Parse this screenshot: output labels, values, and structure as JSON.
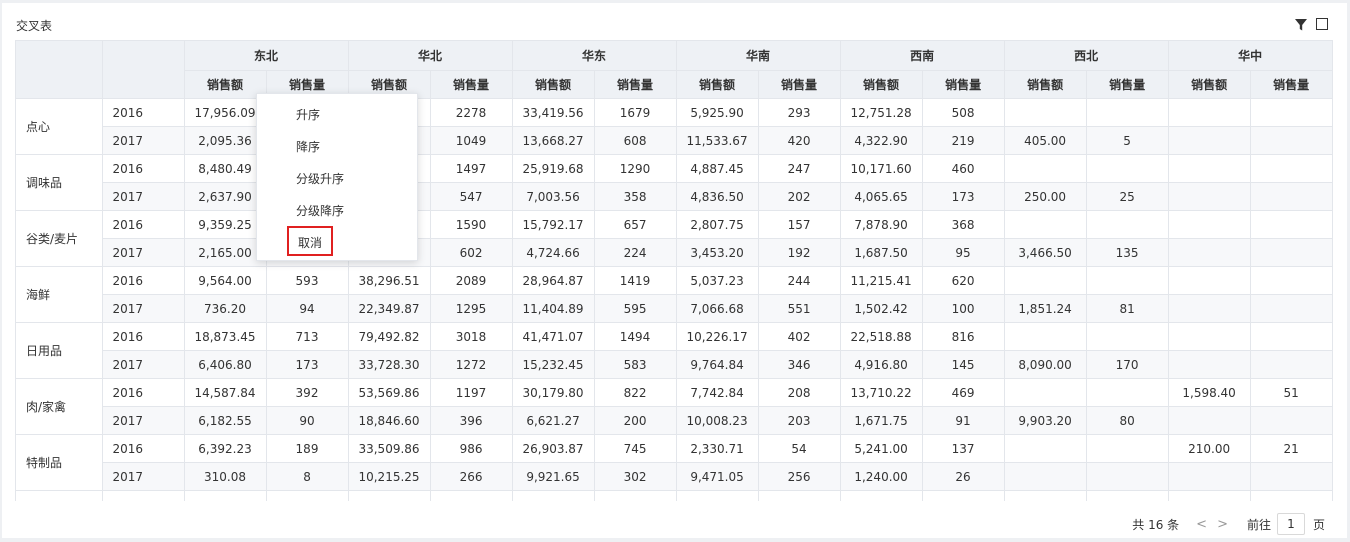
{
  "title": "交叉表",
  "regions": [
    "东北",
    "华北",
    "华东",
    "华南",
    "西南",
    "西北",
    "华中"
  ],
  "measures": [
    "销售额",
    "销售量"
  ],
  "rows": [
    {
      "category": "点心",
      "year": "2016",
      "values": [
        "17,956.09",
        "",
        "",
        "2278",
        "33,419.56",
        "1679",
        "5,925.90",
        "293",
        "12,751.28",
        "508",
        "",
        "",
        "",
        ""
      ]
    },
    {
      "category": "点心",
      "year": "2017",
      "values": [
        "2,095.36",
        "",
        "",
        "1049",
        "13,668.27",
        "608",
        "11,533.67",
        "420",
        "4,322.90",
        "219",
        "405.00",
        "5",
        "",
        ""
      ]
    },
    {
      "category": "调味品",
      "year": "2016",
      "values": [
        "8,480.49",
        "",
        "",
        "1497",
        "25,919.68",
        "1290",
        "4,887.45",
        "247",
        "10,171.60",
        "460",
        "",
        "",
        "",
        ""
      ]
    },
    {
      "category": "调味品",
      "year": "2017",
      "values": [
        "2,637.90",
        "",
        "",
        "547",
        "7,003.56",
        "358",
        "4,836.50",
        "202",
        "4,065.65",
        "173",
        "250.00",
        "25",
        "",
        ""
      ]
    },
    {
      "category": "谷类/麦片",
      "year": "2016",
      "values": [
        "9,359.25",
        "",
        "",
        "1590",
        "15,792.17",
        "657",
        "2,807.75",
        "157",
        "7,878.90",
        "368",
        "",
        "",
        "",
        ""
      ]
    },
    {
      "category": "谷类/麦片",
      "year": "2017",
      "values": [
        "2,165.00",
        "",
        "",
        "602",
        "4,724.66",
        "224",
        "3,453.20",
        "192",
        "1,687.50",
        "95",
        "3,466.50",
        "135",
        "",
        ""
      ]
    },
    {
      "category": "海鲜",
      "year": "2016",
      "values": [
        "9,564.00",
        "593",
        "38,296.51",
        "2089",
        "28,964.87",
        "1419",
        "5,037.23",
        "244",
        "11,215.41",
        "620",
        "",
        "",
        "",
        ""
      ]
    },
    {
      "category": "海鲜",
      "year": "2017",
      "values": [
        "736.20",
        "94",
        "22,349.87",
        "1295",
        "11,404.89",
        "595",
        "7,066.68",
        "551",
        "1,502.42",
        "100",
        "1,851.24",
        "81",
        "",
        ""
      ]
    },
    {
      "category": "日用品",
      "year": "2016",
      "values": [
        "18,873.45",
        "713",
        "79,492.82",
        "3018",
        "41,471.07",
        "1494",
        "10,226.17",
        "402",
        "22,518.88",
        "816",
        "",
        "",
        "",
        ""
      ]
    },
    {
      "category": "日用品",
      "year": "2017",
      "values": [
        "6,406.80",
        "173",
        "33,728.30",
        "1272",
        "15,232.45",
        "583",
        "9,764.84",
        "346",
        "4,916.80",
        "145",
        "8,090.00",
        "170",
        "",
        ""
      ]
    },
    {
      "category": "肉/家禽",
      "year": "2016",
      "values": [
        "14,587.84",
        "392",
        "53,569.86",
        "1197",
        "30,179.80",
        "822",
        "7,742.84",
        "208",
        "13,710.22",
        "469",
        "",
        "",
        "1,598.40",
        "51"
      ]
    },
    {
      "category": "肉/家禽",
      "year": "2017",
      "values": [
        "6,182.55",
        "90",
        "18,846.60",
        "396",
        "6,621.27",
        "200",
        "10,008.23",
        "203",
        "1,671.75",
        "91",
        "9,903.20",
        "80",
        "",
        ""
      ]
    },
    {
      "category": "特制品",
      "year": "2016",
      "values": [
        "6,392.23",
        "189",
        "33,509.86",
        "986",
        "26,903.87",
        "745",
        "2,330.71",
        "54",
        "5,241.00",
        "137",
        "",
        "",
        "210.00",
        "21"
      ]
    },
    {
      "category": "特制品",
      "year": "2017",
      "values": [
        "310.08",
        "8",
        "10,215.25",
        "266",
        "9,921.65",
        "302",
        "9,471.05",
        "256",
        "1,240.00",
        "26",
        "",
        "",
        "",
        ""
      ]
    }
  ],
  "context_menu": {
    "items": [
      "升序",
      "降序",
      "分级升序",
      "分级降序",
      "取消"
    ],
    "highlighted_index": 4
  },
  "pagination": {
    "total": "共 16 条",
    "prev": "<",
    "next": ">",
    "goto_label": "前往",
    "page": "1",
    "page_suffix": "页"
  },
  "icons": {
    "filter": "filter-icon",
    "maximize": "maximize-icon"
  },
  "colors": {
    "header_bg": "#eef1f5",
    "border": "#e3e6eb",
    "highlight": "#e02020"
  }
}
